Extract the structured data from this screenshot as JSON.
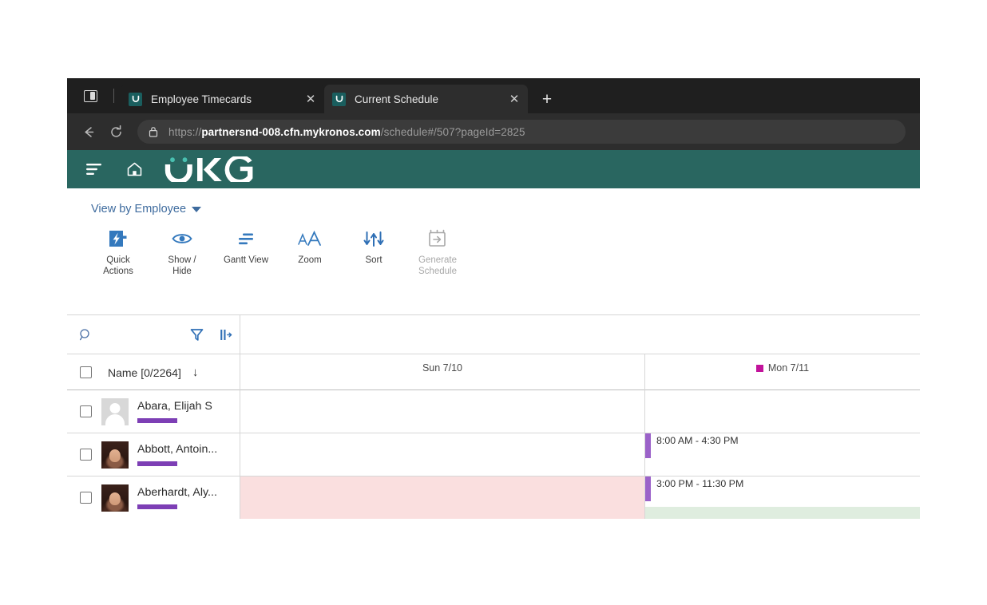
{
  "browser": {
    "tabs": [
      {
        "title": "Employee Timecards",
        "favicon": "ukg-favicon",
        "close_label": "✕",
        "active": false
      },
      {
        "title": "Current Schedule",
        "favicon": "ukg-favicon",
        "close_label": "✕",
        "active": true
      }
    ],
    "new_tab_label": "+",
    "window_icon": "split-pane-icon",
    "back_icon": "back-arrow-icon",
    "reload_icon": "reload-icon",
    "lock_icon": "lock-icon",
    "url": {
      "scheme": "https://",
      "host": "partnersnd-008.cfn.mykronos.com",
      "path": "/schedule#/507?pageId=2825"
    }
  },
  "app": {
    "brand": "UKG",
    "menu_icon": "hamburger-menu-icon",
    "home_icon": "home-icon",
    "header_color": "#296660",
    "view_by": "View by Employee",
    "toolbar": [
      {
        "label": "Quick\nActions",
        "label_line1": "Quick",
        "label_line2": "Actions",
        "icon": "lightning-bolt-icon",
        "disabled": false
      },
      {
        "label": "Show / Hide",
        "label_line1": "Show /",
        "label_line2": "Hide",
        "icon": "eye-icon",
        "disabled": false
      },
      {
        "label": "Gantt View",
        "label_line1": "Gantt View",
        "label_line2": "",
        "icon": "gantt-bars-icon",
        "disabled": false
      },
      {
        "label": "Zoom",
        "label_line1": "Zoom",
        "label_line2": "",
        "icon": "zoom-text-icon",
        "disabled": false
      },
      {
        "label": "Sort",
        "label_line1": "Sort",
        "label_line2": "",
        "icon": "sort-arrows-icon",
        "disabled": false
      },
      {
        "label": "Generate Schedule",
        "label_line1": "Generate",
        "label_line2": "Schedule",
        "icon": "generate-schedule-icon",
        "disabled": true
      }
    ]
  },
  "grid": {
    "controls": {
      "search_icon": "search-icon",
      "filter_icon": "filter-funnel-icon",
      "columns_icon": "column-resize-icon"
    },
    "name_column": {
      "header": "Name [0/2264]",
      "sort_arrow": "↓",
      "select_all_checkbox": false
    },
    "days": [
      {
        "label": "Sun 7/10",
        "marked": false,
        "marker_color": ""
      },
      {
        "label": "Mon 7/11",
        "marked": true,
        "marker_color": "#c2139b"
      }
    ],
    "rows": [
      {
        "name": "Abara, Elijah S",
        "avatar": "generic-avatar",
        "accent_color": "#7d3fb5",
        "checkbox": false,
        "sun_shift": "",
        "sun_highlight": "",
        "mon_shift": "",
        "mon_highlight": ""
      },
      {
        "name": "Abbott, Antoin...",
        "avatar": "photo-avatar",
        "accent_color": "#7d3fb5",
        "checkbox": false,
        "sun_shift": "",
        "sun_highlight": "",
        "mon_shift": "8:00 AM - 4:30 PM",
        "mon_highlight": ""
      },
      {
        "name": "Aberhardt, Aly...",
        "avatar": "photo-avatar",
        "accent_color": "#7d3fb5",
        "checkbox": false,
        "sun_shift": "",
        "sun_highlight": "#fadfdf",
        "mon_shift": "3:00 PM - 11:30 PM",
        "mon_highlight": "#dfeddf"
      }
    ]
  }
}
